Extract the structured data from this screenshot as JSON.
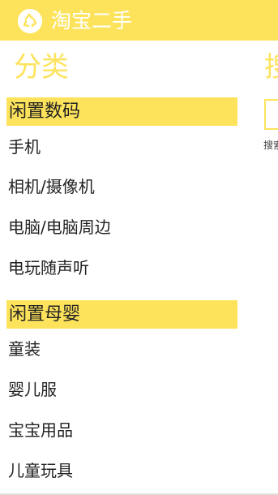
{
  "app": {
    "title": "淘宝二手",
    "logo_icon": "recycle-icon",
    "accent_color": "#fde35c"
  },
  "category_panel": {
    "title": "分类",
    "groups": [
      {
        "header": "闲置数码",
        "items": [
          "手机",
          "相机/摄像机",
          "电脑/电脑周边",
          "电玩随声听"
        ]
      },
      {
        "header": "闲置母婴",
        "items": [
          "童装",
          "婴儿服",
          "宝宝用品",
          "儿童玩具"
        ]
      }
    ]
  },
  "search_panel": {
    "title": "搜",
    "caption": "搜索"
  }
}
